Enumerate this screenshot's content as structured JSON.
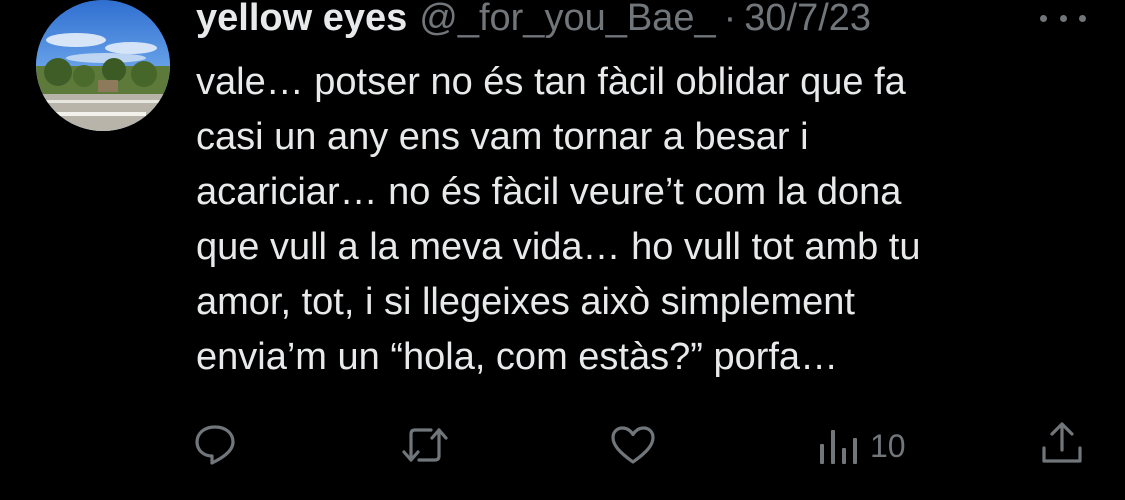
{
  "tweet": {
    "display_name": "yellow eyes",
    "handle": "@_for_you_Bae_",
    "separator": "·",
    "date": "30/7/23",
    "lines": [
      "vale… potser no és tan fàcil oblidar que fa",
      "casi un any ens vam tornar a besar i",
      "acariciar… no és fàcil veure’t com la dona",
      "que vull a la meva vida… ho vull tot amb tu",
      "amor, tot, i si llegeixes això simplement",
      "envia’m un “hola, com estàs?” porfa…"
    ]
  },
  "actions": {
    "reply": {
      "icon": "reply-icon"
    },
    "retweet": {
      "icon": "retweet-icon"
    },
    "like": {
      "icon": "heart-icon"
    },
    "views": {
      "icon": "views-icon",
      "count": "10"
    },
    "share": {
      "icon": "share-icon"
    },
    "more": {
      "icon": "more-dots-icon"
    }
  },
  "colors": {
    "background": "#000000",
    "text_primary": "#e7e9ea",
    "text_secondary": "#71767b"
  }
}
